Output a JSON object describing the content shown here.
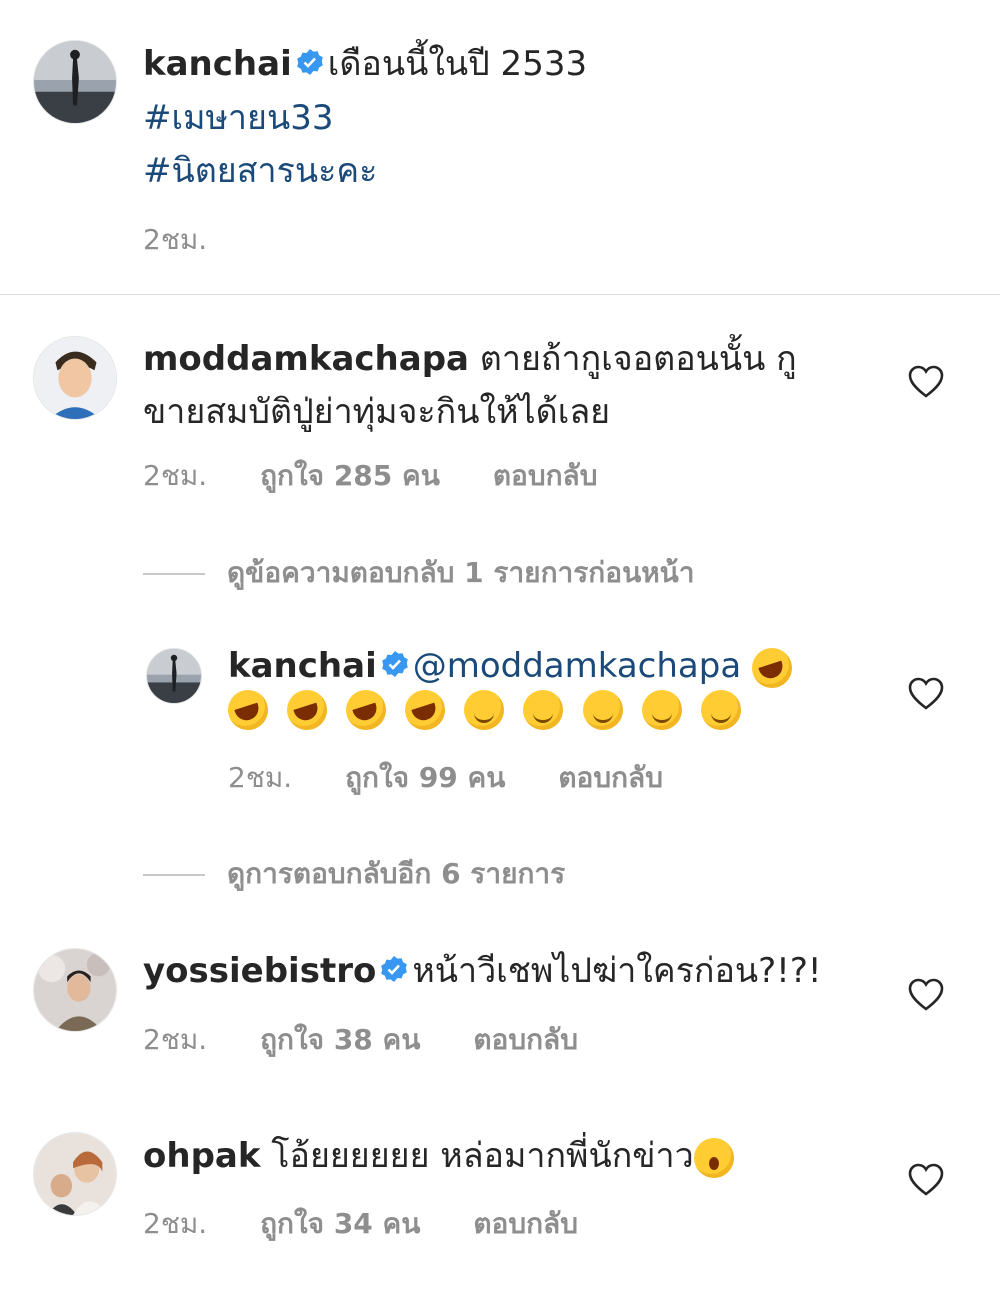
{
  "caption": {
    "username": "kanchai",
    "text": "เดือนนี้ในปี 2533",
    "hashtags": [
      "#เมษายน33",
      "#นิตยสารนะคะ"
    ],
    "time": "2ชม."
  },
  "comments": [
    {
      "username": "moddamkachapa",
      "text_line1": "ตายถ้ากูเจอตอนนั้น กู",
      "text_line2": "ขายสมบัติปู่ย่าทุ่มจะกินให้ได้เลย",
      "time": "2ชม.",
      "likes": "ถูกใจ 285 คน",
      "reply": "ตอบกลับ"
    },
    {
      "username": "yossiebistro",
      "text": "หน้าวีเชพไปฆ่าใครก่อน?!?!",
      "time": "2ชม.",
      "likes": "ถูกใจ 38 คน",
      "reply": "ตอบกลับ"
    },
    {
      "username": "ohpak",
      "text": "โอ้ยยยยยย หล่อมากพี่นักข่าว",
      "time": "2ชม.",
      "likes": "ถูกใจ 34 คน",
      "reply": "ตอบกลับ"
    }
  ],
  "view_previous": "ดูข้อความตอบกลับ 1 รายการก่อนหน้า",
  "reply": {
    "username": "kanchai",
    "mention": "@moddamkachapa",
    "time": "2ชม.",
    "likes": "ถูกใจ 99 คน",
    "reply": "ตอบกลับ"
  },
  "view_more": "ดูการตอบกลับอีก 6 รายการ",
  "icons": {
    "verified": "verified-badge-icon",
    "like": "heart-outline-icon",
    "emoji_rofl": "rolling-on-floor-laughing-emoji",
    "emoji_drool": "drooling-face-emoji",
    "emoji_wow": "astonished-face-emoji"
  },
  "colors": {
    "verified": "#3897f0",
    "hashtag": "#1b4a7a",
    "muted": "#8e8e8e",
    "text": "#262626"
  }
}
